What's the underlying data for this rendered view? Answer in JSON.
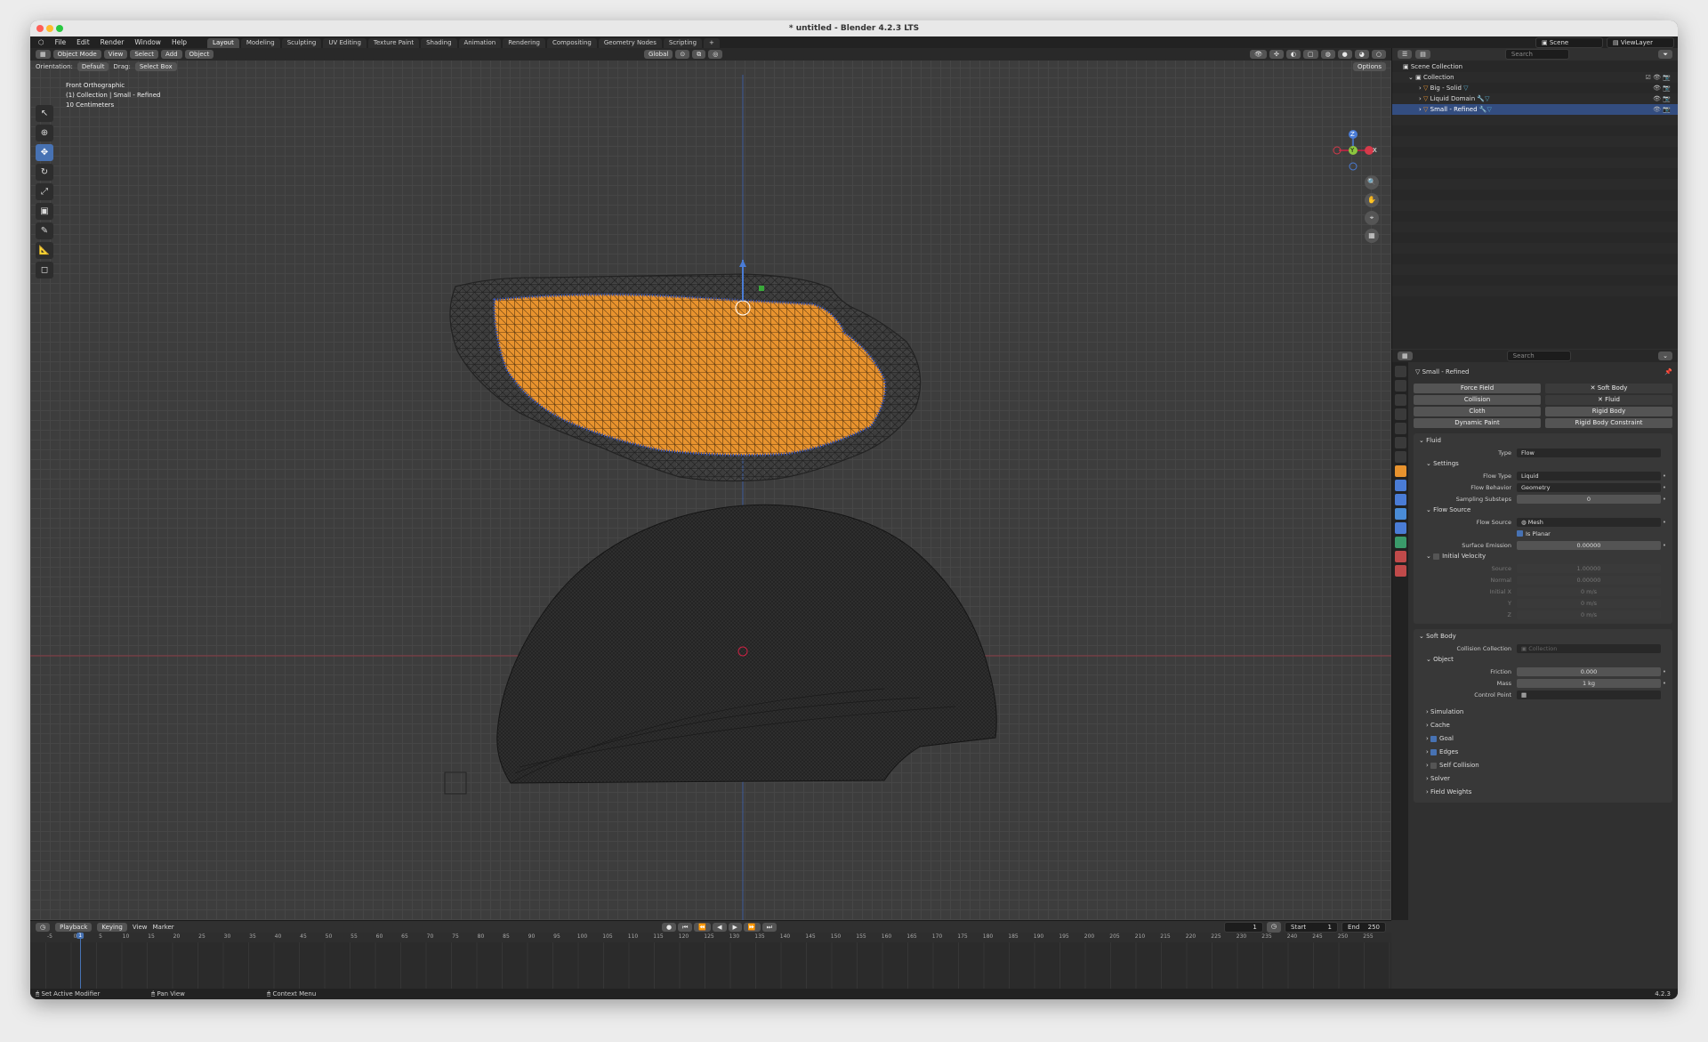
{
  "window": {
    "title": "* untitled - Blender 4.2.3 LTS"
  },
  "menu": [
    "File",
    "Edit",
    "Render",
    "Window",
    "Help"
  ],
  "workspaces": [
    "Layout",
    "Modeling",
    "Sculpting",
    "UV Editing",
    "Texture Paint",
    "Shading",
    "Animation",
    "Rendering",
    "Compositing",
    "Geometry Nodes",
    "Scripting"
  ],
  "active_workspace": "Layout",
  "scene": "Scene",
  "view_layer": "ViewLayer",
  "viewport": {
    "mode": "Object Mode",
    "menus": [
      "View",
      "Select",
      "Add",
      "Object"
    ],
    "orientation_label": "Orientation:",
    "orientation": "Default",
    "drag_label": "Drag:",
    "drag": "Select Box",
    "transform_orientation": "Global",
    "options": "Options",
    "view_name": "Front Orthographic",
    "collection_info": "(1) Collection | Small - Refined",
    "scale": "10 Centimeters",
    "gizmo": {
      "x": "X",
      "y": "Y",
      "z": "Z"
    }
  },
  "outliner": {
    "search_placeholder": "Search",
    "rows": [
      {
        "name": "Scene Collection",
        "depth": 0
      },
      {
        "name": "Collection",
        "depth": 1
      },
      {
        "name": "Big - Solid",
        "depth": 2
      },
      {
        "name": "Liquid Domain",
        "depth": 2
      },
      {
        "name": "Small - Refined",
        "depth": 2,
        "selected": true
      }
    ]
  },
  "properties": {
    "search_placeholder": "Search",
    "object_name": "Small - Refined",
    "physics_buttons": [
      {
        "label": "Force Field",
        "active": false
      },
      {
        "label": "Soft Body",
        "active": true
      },
      {
        "label": "Collision",
        "active": false
      },
      {
        "label": "Fluid",
        "active": true
      },
      {
        "label": "Cloth",
        "active": false
      },
      {
        "label": "Rigid Body",
        "active": false
      },
      {
        "label": "Dynamic Paint",
        "active": false
      },
      {
        "label": "Rigid Body Constraint",
        "active": false
      }
    ],
    "fluid": {
      "title": "Fluid",
      "type_label": "Type",
      "type": "Flow",
      "settings_title": "Settings",
      "flow_type_label": "Flow Type",
      "flow_type": "Liquid",
      "flow_behavior_label": "Flow Behavior",
      "flow_behavior": "Geometry",
      "sampling_label": "Sampling Substeps",
      "sampling": "0",
      "flow_source_title": "Flow Source",
      "flow_source_label": "Flow Source",
      "flow_source": "Mesh",
      "is_planar": "Is Planar",
      "surface_emission_label": "Surface Emission",
      "surface_emission": "0.00000",
      "initial_velocity_title": "Initial Velocity",
      "source_label": "Source",
      "source": "1.00000",
      "normal_label": "Normal",
      "normal": "0.00000",
      "initial_x_label": "Initial X",
      "initial_x": "0 m/s",
      "y_label": "Y",
      "y": "0 m/s",
      "z_label": "Z",
      "z": "0 m/s"
    },
    "soft_body": {
      "title": "Soft Body",
      "collision_collection_label": "Collision Collection",
      "collision_collection_placeholder": "Collection",
      "object_title": "Object",
      "friction_label": "Friction",
      "friction": "0.000",
      "mass_label": "Mass",
      "mass": "1 kg",
      "control_point_label": "Control Point",
      "subpanels": [
        {
          "label": "Simulation",
          "check": null
        },
        {
          "label": "Cache",
          "check": null
        },
        {
          "label": "Goal",
          "check": true
        },
        {
          "label": "Edges",
          "check": true
        },
        {
          "label": "Self Collision",
          "check": false
        },
        {
          "label": "Solver",
          "check": null
        },
        {
          "label": "Field Weights",
          "check": null
        }
      ]
    }
  },
  "timeline": {
    "menus": [
      "Playback",
      "Keying",
      "View",
      "Marker"
    ],
    "current_frame": "1",
    "start_label": "Start",
    "start": "1",
    "end_label": "End",
    "end": "250",
    "ticks": [
      "-5",
      "0",
      "5",
      "10",
      "15",
      "20",
      "25",
      "30",
      "35",
      "40",
      "45",
      "50",
      "55",
      "60",
      "65",
      "70",
      "75",
      "80",
      "85",
      "90",
      "95",
      "100",
      "105",
      "110",
      "115",
      "120",
      "125",
      "130",
      "135",
      "140",
      "145",
      "150",
      "155",
      "160",
      "165",
      "170",
      "175",
      "180",
      "185",
      "190",
      "195",
      "200",
      "205",
      "210",
      "215",
      "220",
      "225",
      "230",
      "235",
      "240",
      "245",
      "250",
      "255"
    ],
    "playhead": "1"
  },
  "status": {
    "left": "Set Active Modifier",
    "middle": "Pan View",
    "right": "Context Menu",
    "version": "4.2.3"
  },
  "colors": {
    "accent": "#4772b3",
    "liquid": "#e8932e",
    "bg": "#3d3d3d"
  }
}
